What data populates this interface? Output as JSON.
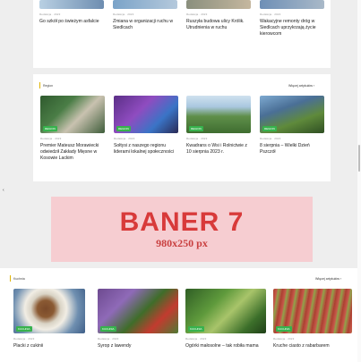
{
  "top_row": {
    "items": [
      {
        "title": "Go szkół po świeżym asfalcie",
        "meta": "Redakcja · 2023"
      },
      {
        "title": "Zmiana w organizacji ruchu w Siedlcach",
        "meta": "Redakcja · 2023"
      },
      {
        "title": "Ruszyła budowa ulicy Królik. Utrudnienia w ruchu",
        "meta": "Redakcja · 2023"
      },
      {
        "title": "Wakacyjne remonty dróg w Siedlcach uprzykrzają życie kierowcom",
        "meta": "Redakcja · 2023"
      }
    ]
  },
  "section_region": {
    "label": "Region",
    "more_link": "Więcej artykułów ›",
    "items": [
      {
        "tag": "REGION",
        "title": "Premier Mateusz Morawiecki odwiedził Zakłady Mięsne w Kosowie Lackim",
        "meta": "Redakcja · 2023"
      },
      {
        "tag": "REGION",
        "title": "Sołtysi z naszego regionu liderami lokalnej społeczności",
        "meta": "Redakcja · 2023"
      },
      {
        "tag": "REGION",
        "title": "Kwadrans o Wsi i Rolnictwie z 10 sierpnia 2023 r.",
        "meta": "Redakcja · 2023"
      },
      {
        "tag": "REGION",
        "title": "8 sierpnia – Wielki Dzień Pszczół",
        "meta": "Redakcja · 2023"
      }
    ]
  },
  "banner": {
    "main": "BANER 7",
    "sub": "980x250 px"
  },
  "section_kuchnia": {
    "label": "Kuchnia",
    "more_link": "Więcej artykułów ›",
    "items": [
      {
        "tag": "KUCHNIA",
        "title": "Placki z cukinii",
        "meta": "Redakcja · 2023"
      },
      {
        "tag": "KUCHNIA",
        "title": "Syrop z lawendy",
        "meta": "Redakcja · 2023"
      },
      {
        "tag": "KUCHNIA",
        "title": "Ogórki małosolne – tak robiła mama",
        "meta": "Redakcja · 2023"
      },
      {
        "tag": "KUCHNIA",
        "title": "Kruche ciasto z rabarbarem",
        "meta": "Redakcja · 2023"
      }
    ]
  },
  "colors": {
    "tag_green": "#37b24d",
    "banner_bg": "#f6cdd1",
    "banner_text": "#d83a3a",
    "accent": "#e0b400"
  }
}
